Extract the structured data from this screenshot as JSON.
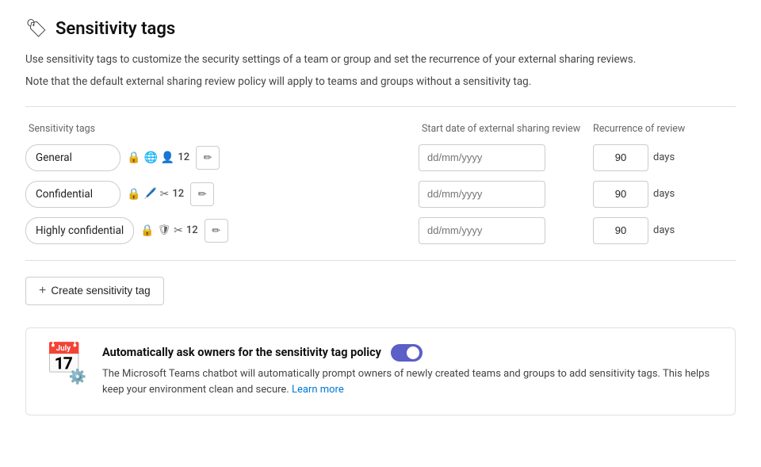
{
  "page": {
    "icon": "🏷",
    "title": "Sensitivity tags",
    "description1": "Use sensitivity tags to customize the security settings of a team or group and set the recurrence of your external sharing reviews.",
    "description2": "Note that the default external sharing review policy will apply to teams and groups without a sensitivity tag."
  },
  "table": {
    "col1": "Sensitivity tags",
    "col2": "Start date of external sharing review",
    "col3": "Recurrence of review"
  },
  "tags": [
    {
      "name": "General",
      "icons": [
        "lock",
        "globe",
        "user"
      ],
      "count": "12",
      "date_placeholder": "dd/mm/yyyy",
      "recurrence": "90",
      "recurrence_unit": "days"
    },
    {
      "name": "Confidential",
      "icons": [
        "lock",
        "noedit",
        "noguest"
      ],
      "count": "12",
      "date_placeholder": "dd/mm/yyyy",
      "recurrence": "90",
      "recurrence_unit": "days"
    },
    {
      "name": "Highly confidential",
      "icons": [
        "lock",
        "shield",
        "noguest"
      ],
      "count": "12",
      "date_placeholder": "dd/mm/yyyy",
      "recurrence": "90",
      "recurrence_unit": "days"
    }
  ],
  "create_btn": "+ Create sensitivity tag",
  "bottom": {
    "title": "Automatically ask owners for the sensitivity tag policy",
    "description": "The Microsoft Teams chatbot will automatically prompt owners of newly created teams and groups to add sensitivity tags. This helps keep your environment clean and secure.",
    "learn_more": "Learn more",
    "toggle_checked": true
  }
}
